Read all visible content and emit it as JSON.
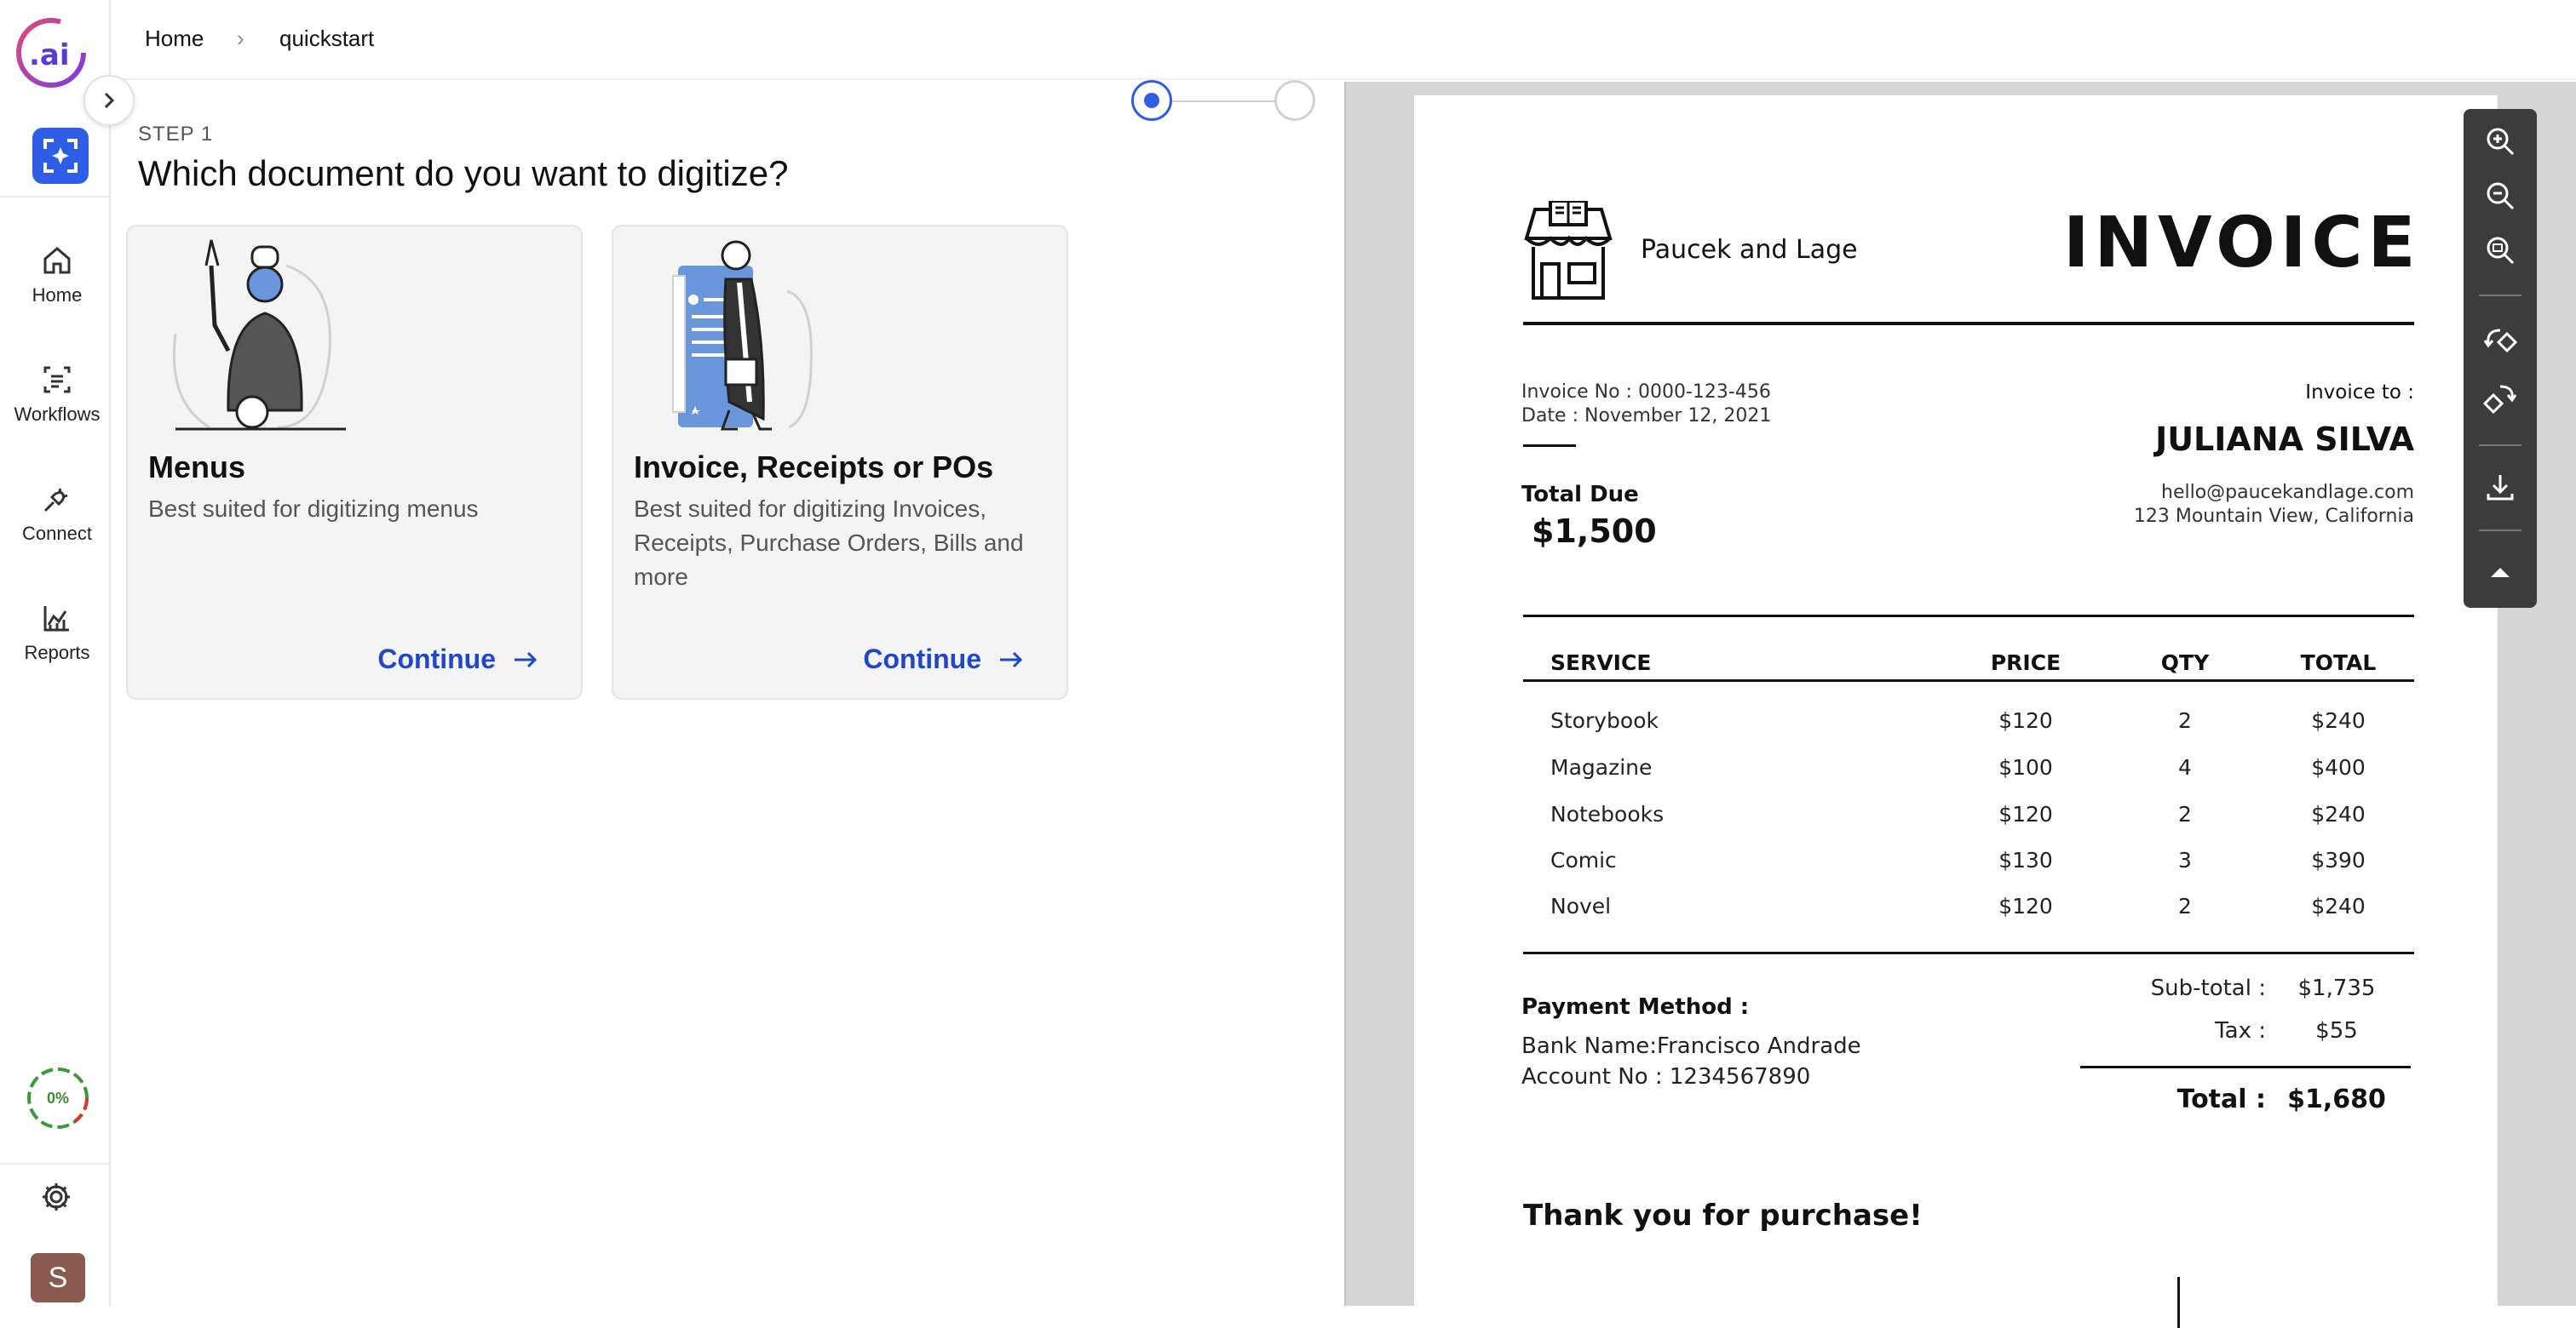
{
  "breadcrumb": {
    "home": "Home",
    "current": "quickstart"
  },
  "sidebar": {
    "items": [
      {
        "label": "Home",
        "icon": "home-icon"
      },
      {
        "label": "Workflows",
        "icon": "workflows-icon"
      },
      {
        "label": "Connect",
        "icon": "plug-icon"
      },
      {
        "label": "Reports",
        "icon": "chart-icon"
      }
    ],
    "progress": "0%",
    "avatar_initial": "S",
    "logo_text": ".ai"
  },
  "step": {
    "label": "STEP 1",
    "title": "Which document do you want to digitize?"
  },
  "cards": [
    {
      "title": "Menus",
      "description": "Best suited for digitizing menus",
      "cta": "Continue"
    },
    {
      "title": "Invoice, Receipts or POs",
      "description": "Best suited for digitizing Invoices, Receipts, Purchase Orders, Bills and more",
      "cta": "Continue"
    }
  ],
  "invoice": {
    "company": "Paucek and Lage",
    "heading": "INVOICE",
    "invoice_no": "Invoice No : 0000-123-456",
    "date": "Date : November 12, 2021",
    "invoice_to_label": "Invoice to :",
    "client_name": "JULIANA SILVA",
    "client_email": "hello@paucekandlage.com",
    "client_address": "123 Mountain View, California",
    "total_due_label": "Total Due",
    "total_due": "$1,500",
    "columns": [
      "SERVICE",
      "PRICE",
      "QTY",
      "TOTAL"
    ],
    "rows": [
      [
        "Storybook",
        "$120",
        "2",
        "$240"
      ],
      [
        "Magazine",
        "$100",
        "4",
        "$400"
      ],
      [
        "Notebooks",
        "$120",
        "2",
        "$240"
      ],
      [
        "Comic",
        "$130",
        "3",
        "$390"
      ],
      [
        "Novel",
        "$120",
        "2",
        "$240"
      ]
    ],
    "payment_label": "Payment Method :",
    "bank_name": "Bank Name:Francisco Andrade",
    "account_no": "Account No : 1234567890",
    "subtotal_label": "Sub-total :",
    "subtotal": "$1,735",
    "tax_label": "Tax :",
    "tax": "$55",
    "total_label": "Total :",
    "total": "$1,680",
    "thanks": "Thank you for purchase!"
  },
  "colors": {
    "accent": "#2f5ee6",
    "link": "#1f47c9",
    "viewer_bg": "#d5d5d5",
    "toolbar_bg": "#3c3c3c"
  }
}
